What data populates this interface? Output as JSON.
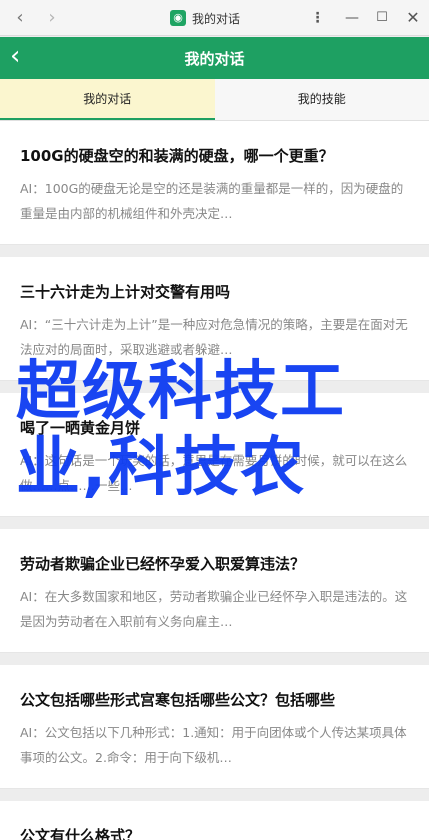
{
  "window": {
    "title": "我的对话",
    "back_glyph": "‹",
    "forward_glyph": "›",
    "more_glyph": "⋮",
    "min_glyph": "—",
    "max_glyph": "☐",
    "close_glyph": "✕"
  },
  "header": {
    "back_glyph": "‹",
    "title": "我的对话"
  },
  "tabs": [
    {
      "label": "我的对话"
    },
    {
      "label": "我的技能"
    }
  ],
  "cards": [
    {
      "title": "100G的硬盘空的和装满的硬盘，哪一个更重？",
      "snippet": "AI：100G的硬盘无论是空的还是装满的重量都是一样的，因为硬盘的重量是由内部的机械组件和外壳决定…"
    },
    {
      "title": "三十六计走为上计对交警有用吗",
      "snippet": "AI：“三十六计走为上计”是一种应对危急情况的策略，主要是在面对无法应对的局面时，采取逃避或者躲避…"
    },
    {
      "title": "喝了一晒黄金月饼",
      "snippet": "AI：这句话是一个玩笑的话，意思是在需要月饼的时候，就可以在这么做……点……一些…"
    },
    {
      "title": "劳动者欺骗企业已经怀孕爱入职爱算违法？",
      "snippet": "AI：在大多数国家和地区，劳动者欺骗企业已经怀孕入职是违法的。这是因为劳动者在入职前有义务向雇主…"
    },
    {
      "title": "公文包括哪些形式宫寒包括哪些公文？包括哪些",
      "snippet": "AI：公文包括以下几种形式：1.通知：用于向团体或个人传达某项具体事项的公文。2.命令：用于向下级机…"
    },
    {
      "title": "公文有什么格式？",
      "snippet": ""
    }
  ],
  "watermark": {
    "line1": "超级科技工",
    "line2": "业,科技农"
  },
  "colors": {
    "brand_green": "#1ea062",
    "active_tab_bg": "#fbf6cf",
    "watermark_blue": "#0d3cf2"
  }
}
